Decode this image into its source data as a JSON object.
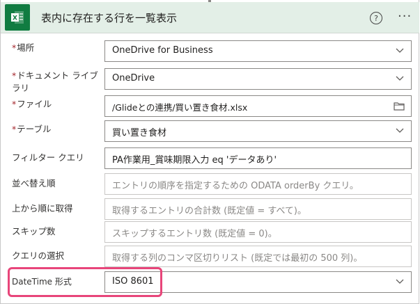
{
  "header": {
    "title": "表内に存在する行を一覧表示",
    "icon": "excel-icon",
    "help_label": "?",
    "more_label": "···",
    "accent": "#107c41",
    "background": "#e3efe7"
  },
  "fields": {
    "location": {
      "required": "*",
      "label": "場所",
      "value": "OneDrive for Business"
    },
    "library": {
      "required": "*",
      "label_line1": "ドキュメント ライブ",
      "label_line2": "ラリ",
      "value": "OneDrive"
    },
    "file": {
      "required": "*",
      "label": "ファイル",
      "value": "/Glideとの連携/買い置き食材.xlsx"
    },
    "table": {
      "required": "*",
      "label": "テーブル",
      "value": "買い置き食材"
    },
    "filter": {
      "label": "フィルター クエリ",
      "value": "PA作業用_賞味期限入力 eq 'データあり'"
    },
    "orderby": {
      "label": "並べ替え順",
      "placeholder": "エントリの順序を指定するための ODATA orderBy クエリ。"
    },
    "top": {
      "label": "上から順に取得",
      "placeholder": "取得するエントリの合計数 (既定値 = すべて)。"
    },
    "skip": {
      "label": "スキップ数",
      "placeholder": "スキップするエントリ数 (既定値 = 0)。"
    },
    "select": {
      "label": "クエリの選択",
      "placeholder": "取得する列のコンマ区切りリスト (既定では最初の 500 列)。"
    },
    "datetime": {
      "label": "DateTime 形式",
      "value": "ISO 8601"
    }
  },
  "highlight_color": "#e8457a"
}
